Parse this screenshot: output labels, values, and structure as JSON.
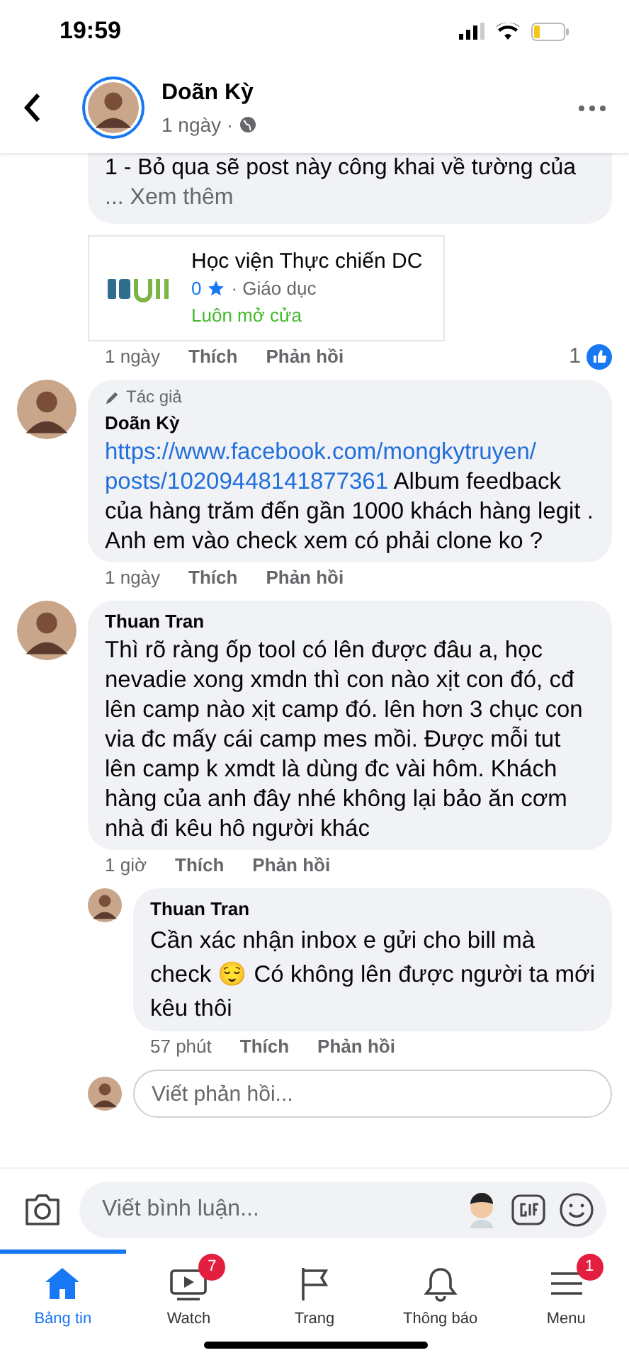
{
  "status_bar": {
    "time": "19:59"
  },
  "header": {
    "name": "Doãn Kỳ",
    "meta": "1 ngày ·"
  },
  "comments": [
    {
      "kind": "continued",
      "text": "1 - Bỏ qua sẽ post này công khai về tường của",
      "see_more": "... Xem thêm",
      "page_card": {
        "title": "Học viện Thực chiến DC",
        "rating": "0",
        "category": "· Giáo dục",
        "status": "Luôn mở cửa"
      },
      "time": "1 ngày",
      "like": "Thích",
      "reply": "Phản hồi",
      "reactions": "1"
    },
    {
      "kind": "comment",
      "badge": "Tác giả",
      "author": "Doãn Kỳ",
      "link_lines": [
        "https://www.facebook.com/mongkytruyen/",
        "posts/10209448141877361"
      ],
      "text": "Album feedback của hàng trăm đến gần 1000 khách hàng legit . Anh em vào check xem có phải clone ko ?",
      "time": "1 ngày",
      "like": "Thích",
      "reply": "Phản hồi"
    },
    {
      "kind": "comment",
      "author": "Thuan Tran",
      "text": "Thì rõ ràng ốp tool có lên được đâu a, học nevadie xong xmdn thì con nào xịt con đó, cđ lên camp nào xịt camp đó. lên hơn 3 chục con via đc mấy cái camp mes mồi. Được mỗi tut lên camp k xmdt là dùng đc vài hôm. Khách hàng của anh đây nhé không lại bảo ăn cơm nhà đi kêu hô người khác",
      "time": "1 giờ",
      "like": "Thích",
      "reply": "Phản hồi"
    },
    {
      "kind": "reply",
      "author": "Thuan Tran",
      "text": "Cần xác nhận inbox e gửi cho bill mà check 😌 Có không lên được người ta mới kêu thôi",
      "time": "57 phút",
      "like": "Thích",
      "reply": "Phản hồi"
    }
  ],
  "reply_field": {
    "placeholder": "Viết phản hồi..."
  },
  "comment_bar": {
    "placeholder": "Viết bình luận..."
  },
  "tabs": [
    {
      "kind": "home",
      "label": "Bảng tin",
      "selected": true
    },
    {
      "kind": "watch",
      "label": "Watch",
      "selected": false,
      "badge": "7"
    },
    {
      "kind": "pages",
      "label": "Trang",
      "selected": false
    },
    {
      "kind": "bell",
      "label": "Thông báo",
      "selected": false
    },
    {
      "kind": "menu",
      "label": "Menu",
      "selected": false,
      "badge": "1"
    }
  ]
}
